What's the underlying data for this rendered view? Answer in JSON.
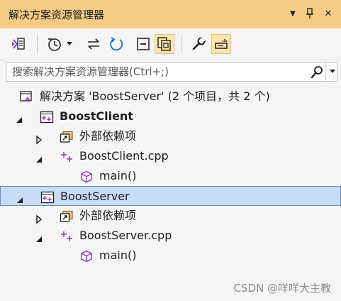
{
  "window": {
    "title": "解决方案资源管理器",
    "dropdown_glyph": "▼",
    "pin_glyph": "⊥",
    "close_glyph": "✕"
  },
  "toolbar": {
    "buttons": [
      {
        "name": "switch-views-icon"
      },
      {
        "name": "pending-changes-icon",
        "has_dropdown": true
      },
      {
        "name": "sync-with-active-document-icon"
      },
      {
        "name": "refresh-icon"
      },
      {
        "name": "collapse-all-icon"
      },
      {
        "name": "show-all-files-icon",
        "active": true
      },
      {
        "name": "properties-wrench-icon"
      },
      {
        "name": "preview-selected-items-icon",
        "active": true
      }
    ]
  },
  "search": {
    "placeholder": "搜索解决方案资源管理器(Ctrl+;)"
  },
  "tree": [
    {
      "level": 0,
      "icon": "solution-icon",
      "label": "解决方案 'BoostServer' (2 个项目，共 2 个)",
      "expander": "none",
      "bold": false
    },
    {
      "level": 0,
      "icon": "cpp-project-icon",
      "label": "BoostClient",
      "expander": "expanded",
      "bold": true
    },
    {
      "level": 1,
      "icon": "external-dependencies-icon",
      "label": "外部依赖项",
      "expander": "collapsed",
      "bold": false
    },
    {
      "level": 1,
      "icon": "cpp-file-icon",
      "label": "BoostClient.cpp",
      "expander": "expanded",
      "bold": false
    },
    {
      "level": 2,
      "icon": "function-cube-icon",
      "label": "main()",
      "expander": "none",
      "bold": false
    },
    {
      "level": 0,
      "icon": "cpp-project-icon",
      "label": "BoostServer",
      "expander": "expanded",
      "bold": false,
      "selected": true
    },
    {
      "level": 1,
      "icon": "external-dependencies-icon",
      "label": "外部依赖项",
      "expander": "collapsed",
      "bold": false
    },
    {
      "level": 1,
      "icon": "cpp-file-icon",
      "label": "BoostServer.cpp",
      "expander": "expanded",
      "bold": false
    },
    {
      "level": 2,
      "icon": "function-cube-icon",
      "label": "main()",
      "expander": "none",
      "bold": false
    }
  ],
  "watermark": "CSDN @咩咩大主教",
  "colors": {
    "title_bar": "#f5cc84",
    "selection": "#c9dcf7",
    "accent_purple": "#8a3ec2"
  }
}
